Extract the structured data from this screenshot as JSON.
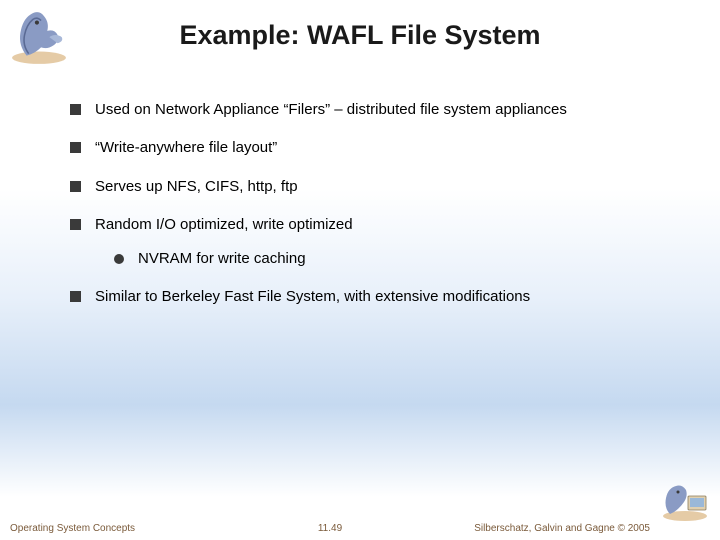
{
  "title": "Example: WAFL File System",
  "bullets": {
    "b1": "Used on Network Appliance “Filers” – distributed file system appliances",
    "b2": "“Write-anywhere file layout”",
    "b3": "Serves up NFS, CIFS, http, ftp",
    "b4": "Random I/O optimized, write optimized",
    "b4a": "NVRAM for write caching",
    "b5": "Similar to Berkeley Fast File System, with extensive modifications"
  },
  "footer": {
    "left": "Operating System Concepts",
    "center": "11.49",
    "right": "Silberschatz, Galvin and Gagne © 2005"
  }
}
